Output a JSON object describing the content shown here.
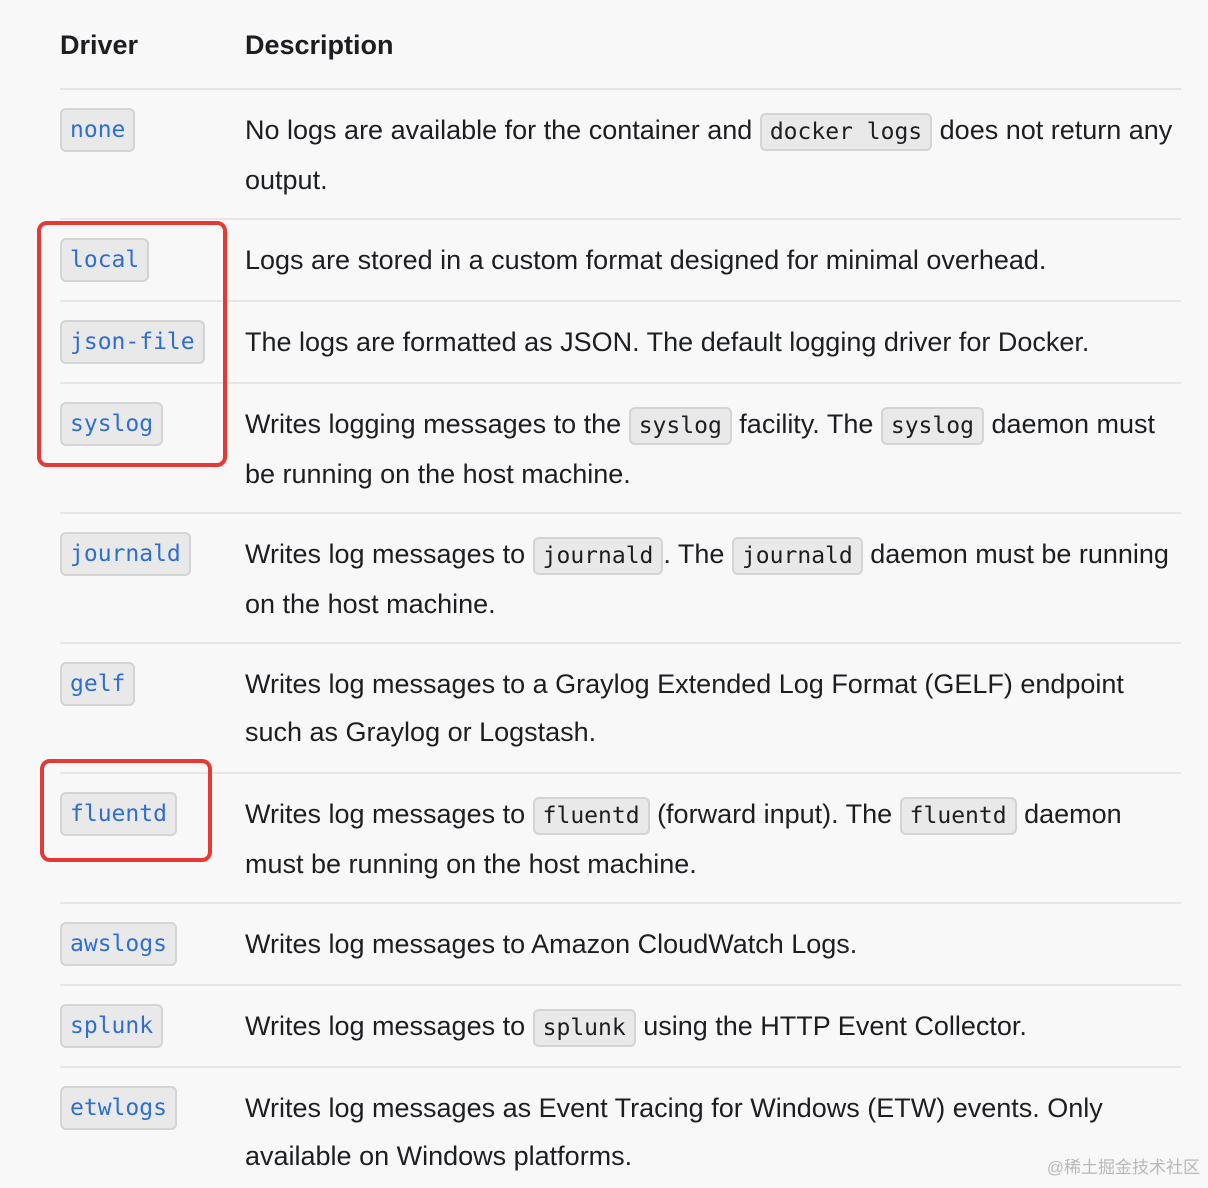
{
  "header": {
    "driver": "Driver",
    "description": "Description"
  },
  "rows": [
    {
      "driver": "none",
      "parts": [
        "No logs are available for the container and ",
        "docker logs",
        " does not return any output."
      ]
    },
    {
      "driver": "local",
      "parts": [
        "Logs are stored in a custom format designed for minimal overhead."
      ]
    },
    {
      "driver": "json-file",
      "parts": [
        "The logs are formatted as JSON. The default logging driver for Docker."
      ]
    },
    {
      "driver": "syslog",
      "parts": [
        "Writes logging messages to the ",
        "syslog",
        " facility. The ",
        "syslog",
        " daemon must be running on the host machine."
      ]
    },
    {
      "driver": "journald",
      "parts": [
        "Writes log messages to ",
        "journald",
        ". The ",
        "journald",
        " daemon must be running on the host machine."
      ]
    },
    {
      "driver": "gelf",
      "parts": [
        "Writes log messages to a Graylog Extended Log Format (GELF) endpoint such as Graylog or Logstash."
      ]
    },
    {
      "driver": "fluentd",
      "parts": [
        "Writes log messages to ",
        "fluentd",
        " (forward input). The ",
        "fluentd",
        " daemon must be running on the host machine."
      ]
    },
    {
      "driver": "awslogs",
      "parts": [
        "Writes log messages to Amazon CloudWatch Logs."
      ]
    },
    {
      "driver": "splunk",
      "parts": [
        "Writes log messages to ",
        "splunk",
        " using the HTTP Event Collector."
      ]
    },
    {
      "driver": "etwlogs",
      "parts": [
        "Writes log messages as Event Tracing for Windows (ETW) events. Only available on Windows platforms."
      ]
    }
  ],
  "watermark": "@稀土掘金技术社区",
  "colors": {
    "highlight": "#e53935",
    "driver_code": "#2f6ed1"
  }
}
